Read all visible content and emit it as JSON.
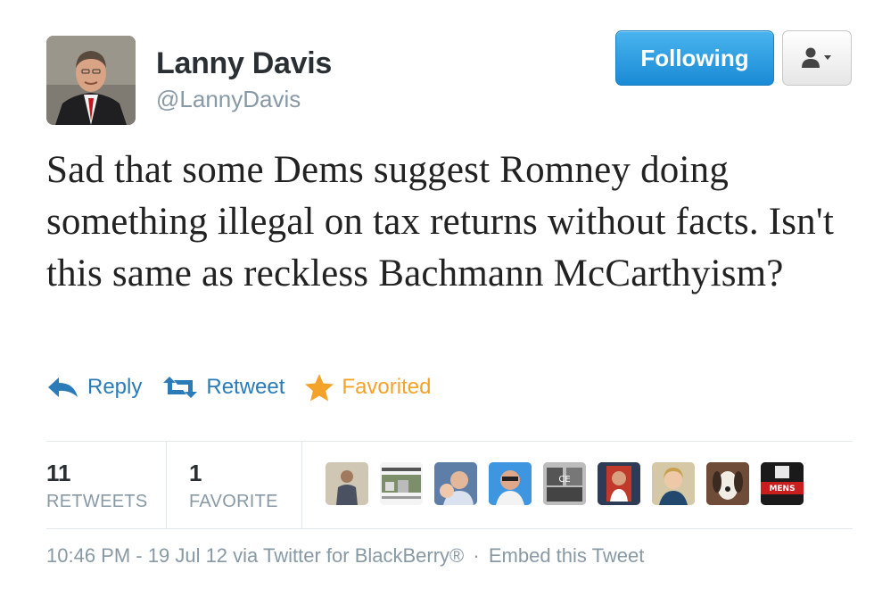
{
  "author": {
    "name": "Lanny Davis",
    "handle": "@LannyDavis"
  },
  "header": {
    "following_label": "Following",
    "user_menu_icon": "user-dropdown-icon"
  },
  "tweet": {
    "text": "Sad that some Dems suggest Romney doing something illegal on tax returns without facts. Isn't this same as reckless Bachmann McCarthyism?"
  },
  "actions": {
    "reply_label": "Reply",
    "retweet_label": "Retweet",
    "favorited_label": "Favorited"
  },
  "stats": {
    "retweets_count": "11",
    "retweets_label": "RETWEETS",
    "favorites_count": "1",
    "favorites_label": "FAVORITE"
  },
  "meta": {
    "time": "10:46 PM",
    "date": "19 Jul 12",
    "via": "via Twitter for BlackBerry®",
    "embed_label": "Embed this Tweet"
  },
  "colors": {
    "follow_button": "#1a8ad5",
    "link_blue": "#2b7bb9",
    "favorite_orange": "#f4a32a",
    "muted": "#8899a6"
  }
}
